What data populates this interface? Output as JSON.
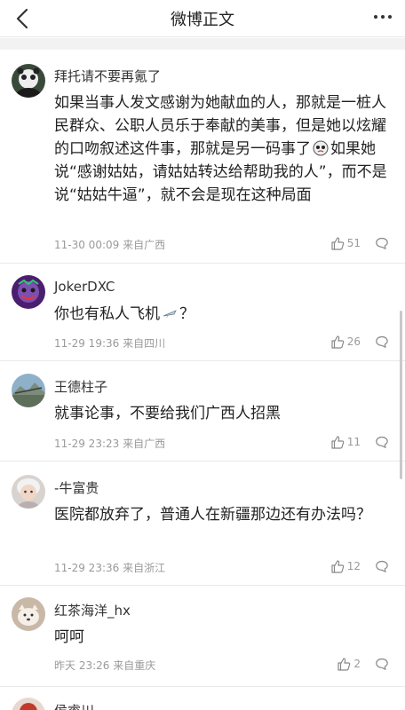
{
  "nav": {
    "title": "微博正文"
  },
  "comments": [
    {
      "name": "拜托请不要再氪了",
      "text": "如果当事人发文感谢为她献血的人，那就是一桩人民群众、公职人员乐于奉献的美事，但是她以炫耀的口吻叙述这件事，那就是另一码事了",
      "text2": "如果她说“感谢姑姑，请姑姑转达给帮助我的人”，而不是说“姑姑牛逼”，就不会是现在这种局面",
      "time": "11-30 00:09",
      "location": "来自广西",
      "likes": "51"
    },
    {
      "name": "JokerDXC",
      "text": "你也有私人飞机",
      "text2": "？",
      "time": "11-29 19:36",
      "location": "来自四川",
      "likes": "26"
    },
    {
      "name": "王德柱子",
      "text": "就事论事，不要给我们广西人招黑",
      "time": "11-29 23:23",
      "location": "来自广西",
      "likes": "11"
    },
    {
      "name": "-牛富贵",
      "text": "医院都放弃了，普通人在新疆那边还有办法吗？",
      "time": "11-29 23:36",
      "location": "来自浙江",
      "likes": "12"
    },
    {
      "name": "红茶海洋_hx",
      "text": "呵呵",
      "time": "昨天 23:26",
      "location": "来自重庆",
      "likes": "2"
    },
    {
      "name": "侯睿川"
    }
  ]
}
